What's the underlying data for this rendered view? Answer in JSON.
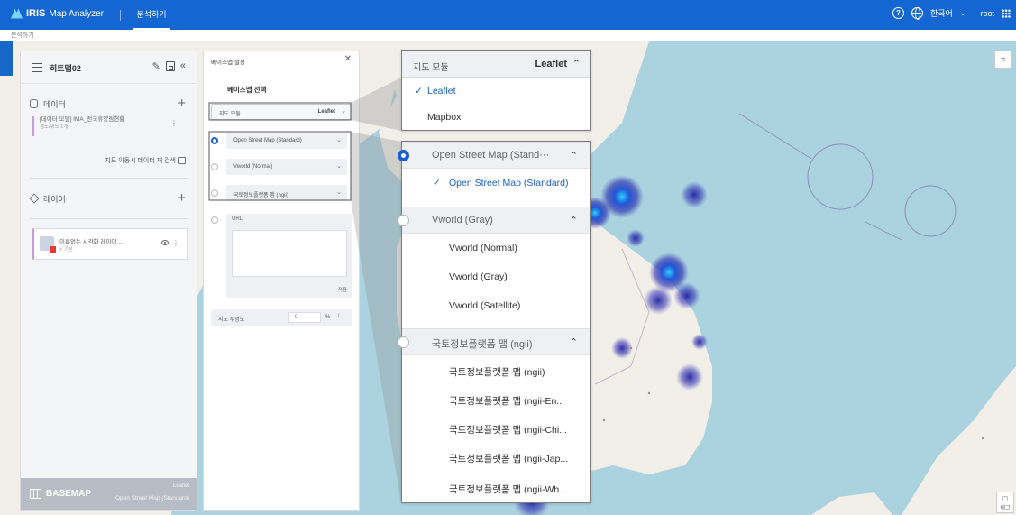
{
  "topbar": {
    "brand": "IRIS",
    "app_name": "Map Analyzer",
    "tab_label": "분석하기",
    "language": "한국어",
    "user": "root"
  },
  "breadcrumb": "분석하기",
  "left_panel": {
    "map_title": "히트맵02",
    "data_section": "데이터",
    "data_item_name": "[데이터 모델] IMA_전국휴양림현황",
    "data_item_sub": "경도/위도 1개",
    "search_option": "지도 이동시 데이터 재 검색",
    "layer_section": "레이어",
    "layer_name": "이름없는 시각화 레이어 ...",
    "layer_sub": "> 기본",
    "basemap_label": "BASEMAP",
    "basemap_lib": "Leaflet",
    "basemap_current": "Open Street Map (Standard)"
  },
  "basemap_panel": {
    "title": "베이스맵 설정",
    "select_label": "베이스맵 선택",
    "module_label": "지도 모듈",
    "module_value": "Leaflet",
    "options": [
      "Open Street Map (Standard)",
      "Vworld (Normal)",
      "국토정보플랫폼 맵 (ngii)"
    ],
    "url_label": "URL",
    "apply": "적용",
    "opacity_label": "지도 투명도",
    "opacity_value": "0",
    "opacity_unit": "%"
  },
  "zoom_library": {
    "label": "지도 모듈",
    "value": "Leaflet",
    "items": [
      "Leaflet",
      "Mapbox"
    ]
  },
  "zoom_maps": {
    "group1": "Open Street Map (Stand···",
    "group1_items": [
      "Open Street Map (Standard)"
    ],
    "group2": "Vworld (Gray)",
    "group2_items": [
      "Vworld (Normal)",
      "Vworld (Gray)",
      "Vworld (Satellite)"
    ],
    "group3": "국토정보플랫폼 맵 (ngii)",
    "group3_items": [
      "국토정보플랫폼 맵 (ngii)",
      "국토정보플랫폼 맵 (ngii-En...",
      "국토정보플랫폼 맵 (ngii-Chi...",
      "국토정보플랫폼 맵 (ngii-Jap...",
      "국토정보플랫폼 맵 (ngii-Wh..."
    ]
  },
  "map_controls": {
    "bottom_right": "배그"
  },
  "colors": {
    "topbar": "#1467d3",
    "accent": "#1a5fd0",
    "layer_marker": "#c89adb"
  }
}
